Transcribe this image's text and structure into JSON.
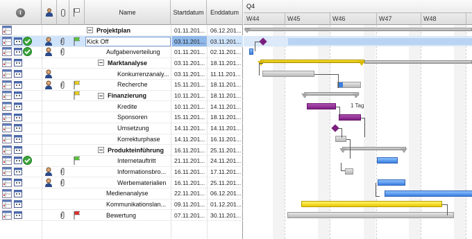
{
  "grid": {
    "columns": {
      "info_icon": "info-icon",
      "resource_icon": "person-icon",
      "attachment_icon": "paperclip-icon",
      "flag_icon": "flag-icon",
      "name": "Name",
      "start": "Startdatum",
      "end": "Enddatum"
    },
    "editing_value": "Kick Off",
    "rows": [
      {
        "name": "Projektplan",
        "start": "01.11.201...",
        "end": "06.12.201...",
        "level": 0,
        "bold": true,
        "group": true
      },
      {
        "name": "Kick Off",
        "start": "03.11.201...",
        "end": "03.11.201...",
        "level": 1,
        "selected": true,
        "check": true,
        "person": true,
        "clip": true,
        "flag": "green"
      },
      {
        "name": "Aufgabenverteilung",
        "start": "01.11.201...",
        "end": "02.11.201...",
        "level": 1,
        "check": true,
        "person": true,
        "clip": true
      },
      {
        "name": "Marktanalyse",
        "start": "03.11.201...",
        "end": "18.11.201...",
        "level": 1,
        "bold": true,
        "group": true
      },
      {
        "name": "Konkurrenzanaly...",
        "start": "03.11.201...",
        "end": "11.11.201...",
        "level": 2,
        "person": true
      },
      {
        "name": "Recherche",
        "start": "15.11.201...",
        "end": "18.11.201...",
        "level": 2,
        "person": true,
        "clip": true,
        "flag": "yellow"
      },
      {
        "name": "Finanzierung",
        "start": "10.11.201...",
        "end": "18.11.201...",
        "level": 1,
        "bold": true,
        "group": true,
        "flag": "yellow"
      },
      {
        "name": "Kredite",
        "start": "10.11.201...",
        "end": "14.11.201...",
        "level": 2
      },
      {
        "name": "Sponsoren",
        "start": "15.11.201...",
        "end": "18.11.201...",
        "level": 2
      },
      {
        "name": "Umsetzung",
        "start": "14.11.201...",
        "end": "14.11.201...",
        "level": 2
      },
      {
        "name": "Korrekturphase",
        "start": "14.11.201...",
        "end": "16.11.201...",
        "level": 2
      },
      {
        "name": "Produkteinführung",
        "start": "16.11.201...",
        "end": "25.11.201...",
        "level": 1,
        "bold": true,
        "group": true
      },
      {
        "name": "Internetauftritt",
        "start": "21.11.201...",
        "end": "24.11.201...",
        "level": 2,
        "check": true,
        "flag": "green"
      },
      {
        "name": "Informationsbro...",
        "start": "16.11.201...",
        "end": "17.11.201...",
        "level": 2,
        "person": true,
        "clip": true
      },
      {
        "name": "Werbematerialien",
        "start": "16.11.201...",
        "end": "25.11.201...",
        "level": 2,
        "person": true,
        "clip": true
      },
      {
        "name": "Medienanalyse",
        "start": "22.11.201...",
        "end": "06.12.201...",
        "level": 1
      },
      {
        "name": "Kommunikationslan...",
        "start": "09.11.201...",
        "end": "01.12.201...",
        "level": 1
      },
      {
        "name": "Bewertung",
        "start": "07.11.201...",
        "end": "30.11.201...",
        "level": 1,
        "clip": true,
        "flag": "red"
      }
    ]
  },
  "gantt": {
    "quarter": "Q4",
    "weeks": [
      "W44",
      "W45",
      "W46",
      "W47",
      "W48"
    ],
    "annotation": "1 Tag"
  },
  "colors": {
    "task_gray": "#b8b8b8",
    "task_purple": "#7a1f7e",
    "task_blue": "#3b7ee0",
    "task_yellow": "#e8c800",
    "selection": "#cfe4fb"
  }
}
